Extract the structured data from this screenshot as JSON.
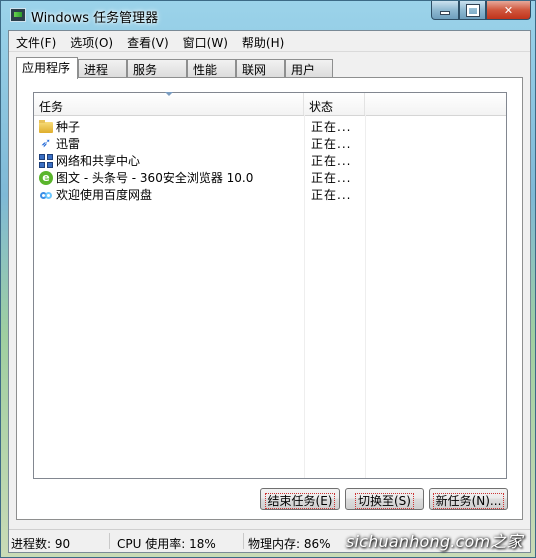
{
  "window": {
    "title": "Windows 任务管理器",
    "minimize_glyph": "",
    "maximize_glyph": "",
    "close_glyph": "✕"
  },
  "menu": [
    {
      "label": "文件(F)"
    },
    {
      "label": "选项(O)"
    },
    {
      "label": "查看(V)"
    },
    {
      "label": "窗口(W)"
    },
    {
      "label": "帮助(H)"
    }
  ],
  "tabs": [
    {
      "label": "应用程序",
      "active": true
    },
    {
      "label": "进程"
    },
    {
      "label": "服务"
    },
    {
      "label": "性能"
    },
    {
      "label": "联网"
    },
    {
      "label": "用户"
    }
  ],
  "columns": {
    "task": "任务",
    "status": "状态"
  },
  "tasks": [
    {
      "name": "种子",
      "status": "正在...",
      "icon": "folder-icon"
    },
    {
      "name": "迅雷",
      "status": "正在...",
      "icon": "thunder-bird-icon"
    },
    {
      "name": "网络和共享中心",
      "status": "正在...",
      "icon": "network-center-icon"
    },
    {
      "name": "图文 - 头条号 - 360安全浏览器 10.0",
      "status": "正在...",
      "icon": "browser-e-icon"
    },
    {
      "name": "欢迎使用百度网盘",
      "status": "正在...",
      "icon": "baidu-cloud-icon"
    }
  ],
  "buttons": {
    "end_task": "结束任务(E)",
    "switch_to": "切换至(S)",
    "new_task": "新任务(N)..."
  },
  "status_bar": {
    "processes": "进程数: 90",
    "cpu": "CPU 使用率: 18%",
    "memory": "物理内存: 86%"
  },
  "watermark": "sichuanhong.com之家",
  "colors": {
    "close_button": "#c0331b",
    "frame_blue": "#7fb9d6"
  }
}
